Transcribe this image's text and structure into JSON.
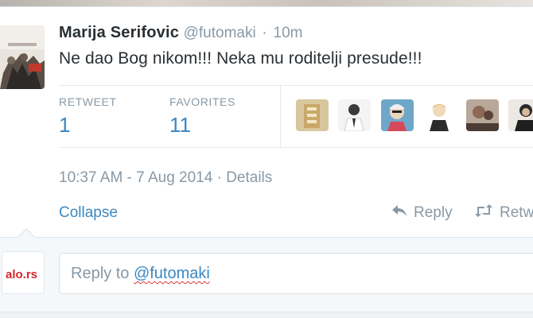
{
  "tweet": {
    "fullname": "Marija Serifovic",
    "username": "@futomaki",
    "separator": "·",
    "time": "10m",
    "text": "Ne dao Bog nikom!!! Neka mu roditelji presude!!!",
    "avatar_icon": "user-avatar-photo"
  },
  "stats": {
    "retweet_label": "RETWEET",
    "retweet_count": "1",
    "favorites_label": "FAVORITES",
    "favorites_count": "11",
    "facepile": [
      {
        "name": "favoriter-avatar-1",
        "color": "#c9a86a"
      },
      {
        "name": "favoriter-avatar-2",
        "color": "#3a3a3a"
      },
      {
        "name": "favoriter-avatar-3",
        "color": "#d9c7a8"
      },
      {
        "name": "favoriter-avatar-4",
        "color": "#e8d3b8"
      },
      {
        "name": "favoriter-avatar-5",
        "color": "#7a5b4a"
      },
      {
        "name": "favoriter-avatar-6",
        "color": "#2c2a2a"
      },
      {
        "name": "favoriter-avatar-7",
        "color": "#6b6b6b"
      }
    ]
  },
  "metadata": {
    "timestamp": "10:37 AM - 7 Aug 2014",
    "separator": "·",
    "details": "Details"
  },
  "actions": {
    "collapse": "Collapse",
    "reply": "Reply",
    "retweet": "Retw",
    "reply_icon": "reply-icon",
    "retweet_icon": "retweet-icon"
  },
  "reply_box": {
    "prefix": "Reply to ",
    "mention": "@futomaki",
    "avatar_logo": "alo.rs"
  },
  "colors": {
    "link": "#3b88c3",
    "muted": "#8899a6",
    "text": "#292f33"
  }
}
